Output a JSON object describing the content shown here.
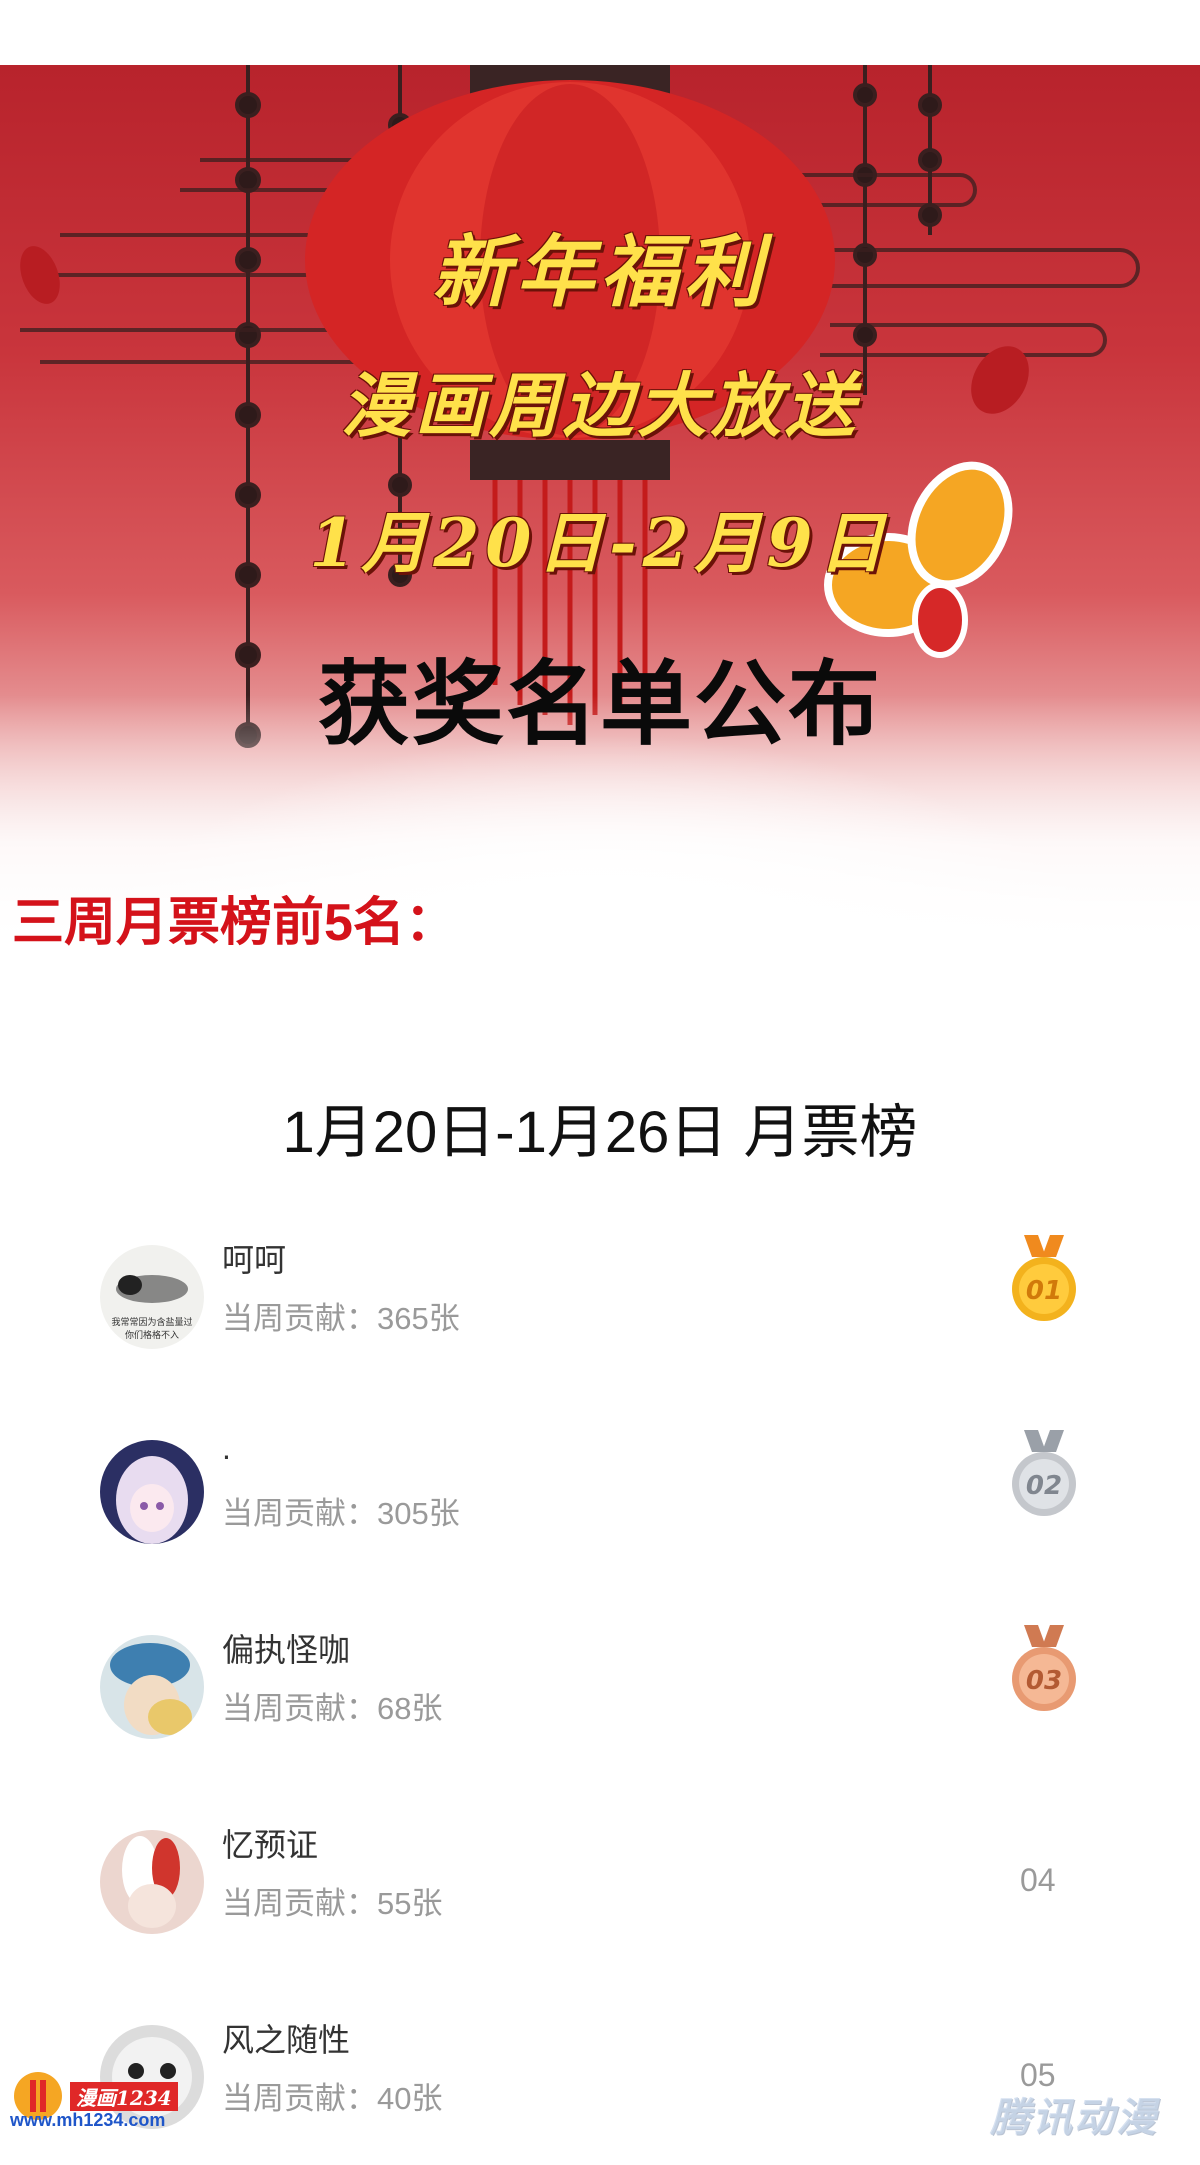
{
  "banner": {
    "title_line1": "新年福利",
    "title_line2": "漫画周边大放送",
    "title_line3": "1月20日-2月9日",
    "heading": "获奖名单公布"
  },
  "section_title": "三周月票榜前5名：",
  "week_title": "1月20日-1月26日 月票榜",
  "ranking": [
    {
      "name": "呵呵",
      "contribution": "当周贡献：365张",
      "rank": "01",
      "medal": "gold"
    },
    {
      "name": ".",
      "contribution": "当周贡献：305张",
      "rank": "02",
      "medal": "silver"
    },
    {
      "name": "偏执怪咖",
      "contribution": "当周贡献：68张",
      "rank": "03",
      "medal": "bronze"
    },
    {
      "name": "忆预证",
      "contribution": "当周贡献：55张",
      "rank": "04",
      "medal": "none"
    },
    {
      "name": "风之随性",
      "contribution": "当周贡献：40张",
      "rank": "05",
      "medal": "none"
    }
  ],
  "avatar1_caption": "我常常因为含盐量过\n你们格格不入",
  "watermarks": {
    "left_brand": "漫画1234",
    "left_url": "www.mh1234.com",
    "right": "腾讯动漫"
  },
  "colors": {
    "accent_red": "#d4121a",
    "title_yellow": "#ffe14a",
    "gold": "#f3b21d",
    "silver": "#c4c7cc",
    "bronze": "#e89a72"
  }
}
